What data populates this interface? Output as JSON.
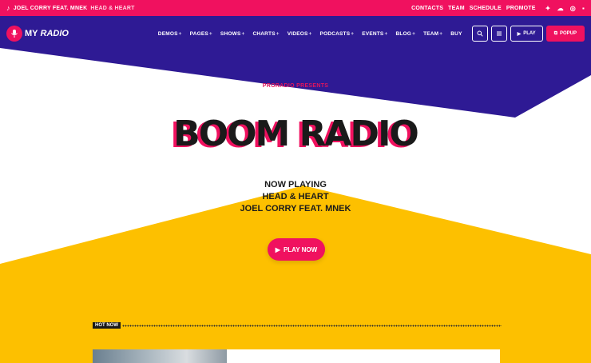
{
  "colors": {
    "primary": "#f0115f",
    "indigo": "#2e1a94",
    "yellow": "#fdc000",
    "dark": "#1a1a1a"
  },
  "topbar": {
    "artist": "JOEL CORRY FEAT. MNEK",
    "title": "HEAD & HEART",
    "links": [
      "CONTACTS",
      "TEAM",
      "SCHEDULE",
      "PROMOTE"
    ],
    "social_icons": [
      "twitter-icon",
      "soundcloud-icon",
      "instagram-icon",
      "facebook-icon"
    ]
  },
  "header": {
    "logo_my": "MY",
    "logo_radio": "RADIO",
    "nav": [
      "DEMOS",
      "PAGES",
      "SHOWS",
      "CHARTS",
      "VIDEOS",
      "PODCASTS",
      "EVENTS",
      "BLOG",
      "TEAM",
      "BUY"
    ],
    "play_label": "PLAY",
    "popup_label": "POPUP"
  },
  "hero": {
    "presents": "PRORADIO PRESENTS",
    "title": "BOOM RADIO",
    "now_playing_label": "NOW PLAYING",
    "song": "HEAD & HEART",
    "artist": "JOEL CORRY FEAT. MNEK",
    "cta_label": "PLAY NOW"
  },
  "hot_now": {
    "label": "HOT NOW"
  }
}
